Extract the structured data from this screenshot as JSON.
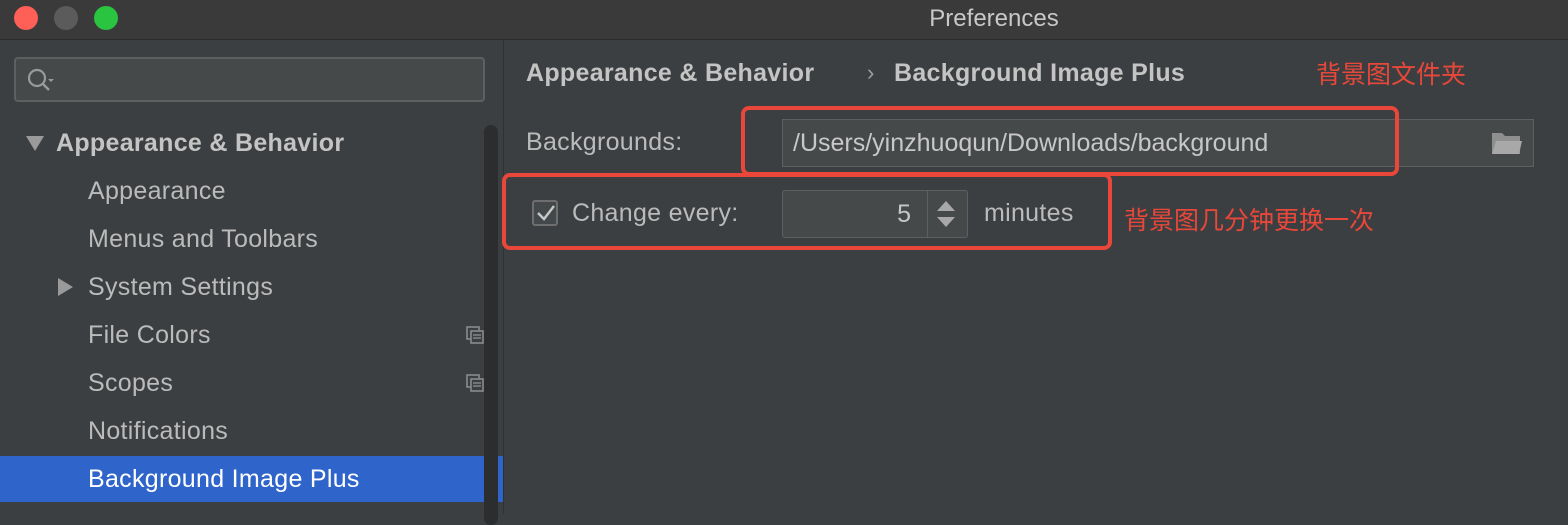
{
  "window": {
    "title": "Preferences"
  },
  "sidebar": {
    "search": {
      "placeholder": ""
    },
    "items": [
      {
        "label": "Appearance & Behavior",
        "expanded": true
      },
      {
        "label": "Appearance"
      },
      {
        "label": "Menus and Toolbars"
      },
      {
        "label": "System Settings",
        "expanded": false
      },
      {
        "label": "File Colors",
        "icon": "copy-icon"
      },
      {
        "label": "Scopes",
        "icon": "copy-icon"
      },
      {
        "label": "Notifications"
      },
      {
        "label": "Background Image Plus",
        "selected": true
      }
    ]
  },
  "content": {
    "breadcrumb": [
      "Appearance & Behavior",
      "Background Image Plus"
    ],
    "breadcrumb_separator": "›",
    "backgrounds_label": "Backgrounds:",
    "backgrounds_path": "/Users/yinzhuoqun/Downloads/background",
    "change_every_checked": true,
    "change_every_label": "Change every:",
    "change_every_value": "5",
    "change_every_unit": "minutes",
    "annotation_folder": "背景图文件夹",
    "annotation_interval": "背景图几分钟更换一次"
  },
  "colors": {
    "accent_selected": "#2f65ca",
    "annotation_red": "#e8473a",
    "background": "#3c3f41"
  }
}
